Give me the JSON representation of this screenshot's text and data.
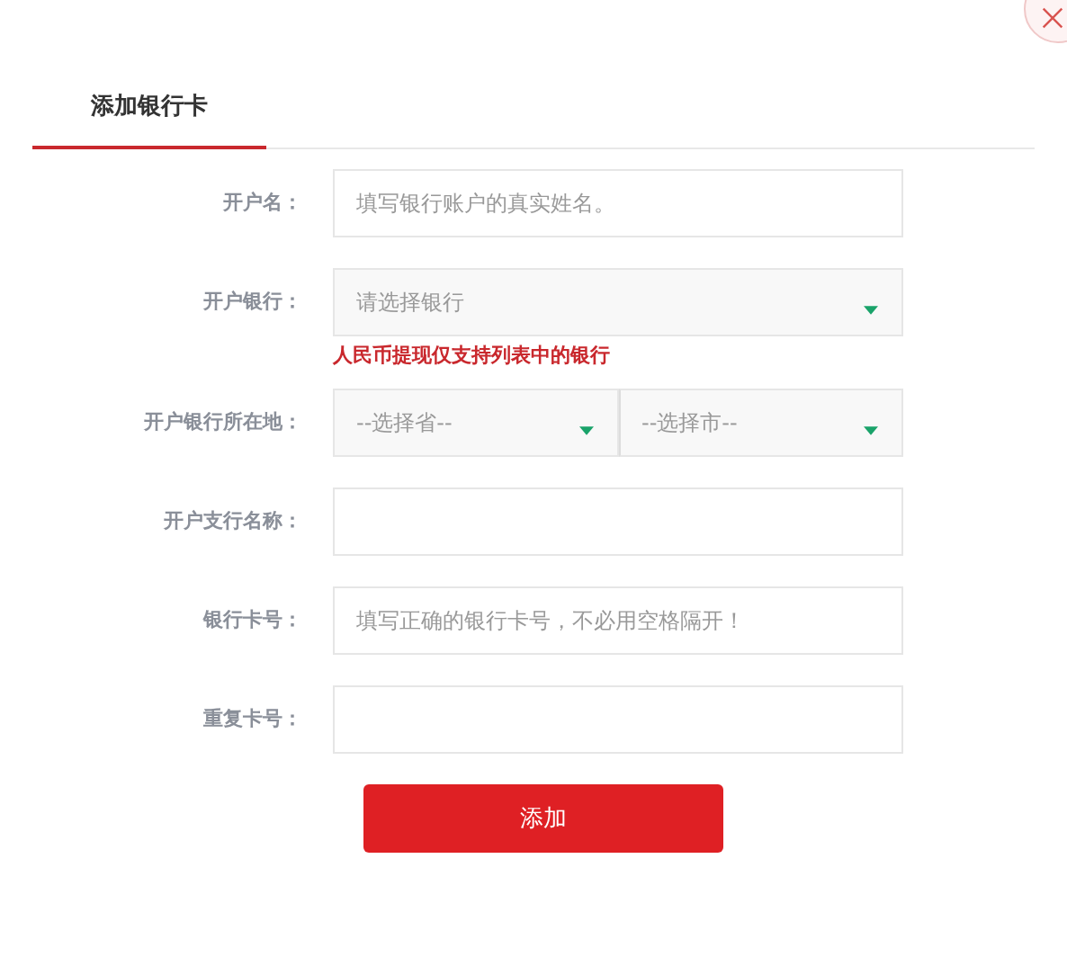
{
  "tabs": [
    {
      "label": "添加银行卡",
      "selected": true
    }
  ],
  "fields": [
    {
      "kind": "input",
      "label": "开户名：",
      "placeholder": "填写银行账户的真实姓名。"
    },
    {
      "kind": "select",
      "label": "开户银行：",
      "selects": [
        {
          "placeholder": "请选择银行"
        }
      ],
      "hint": "人民币提现仅支持列表中的银行"
    },
    {
      "kind": "select",
      "label": "开户银行所在地：",
      "selects": [
        {
          "placeholder": "--选择省--"
        },
        {
          "placeholder": "--选择市--"
        }
      ]
    },
    {
      "kind": "input",
      "label": "开户支行名称："
    },
    {
      "kind": "input",
      "label": "银行卡号：",
      "placeholder": "填写正确的银行卡号，不必用空格隔开！"
    },
    {
      "kind": "input",
      "label": "重复卡号："
    }
  ],
  "submit": {
    "label": "添加"
  }
}
